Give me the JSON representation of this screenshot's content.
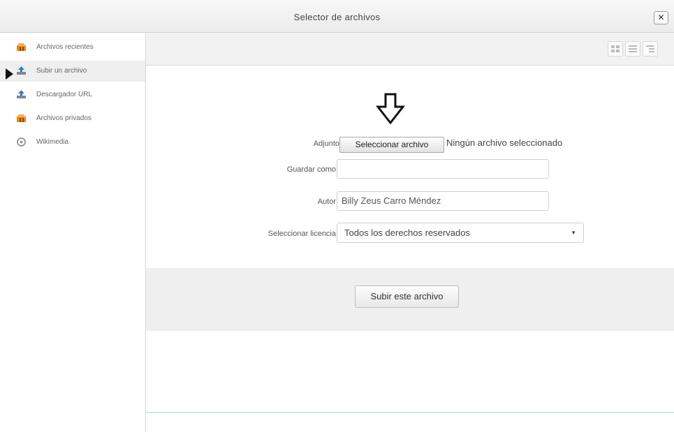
{
  "window": {
    "title": "Selector de archivos",
    "close_glyph": "✕"
  },
  "sidebar": {
    "items": [
      {
        "label": "Archivos recientes",
        "icon": "recent-files-icon"
      },
      {
        "label": "Subir un archivo",
        "icon": "upload-icon"
      },
      {
        "label": "Descargador URL",
        "icon": "url-downloader-icon"
      },
      {
        "label": "Archivos privados",
        "icon": "private-files-icon"
      },
      {
        "label": "Wikimedia",
        "icon": "wikimedia-icon"
      }
    ],
    "active_index": 1
  },
  "toolbar": {
    "views": [
      "icon-view-icon",
      "list-view-icon",
      "tree-view-icon"
    ]
  },
  "form": {
    "attachment_label": "Adjunto",
    "choose_file_button": "Seleccionar archivo",
    "no_file_text": "Ningún archivo seleccionado",
    "save_as_label": "Guardar como",
    "save_as_value": "",
    "author_label": "Autor",
    "author_value": "Billy Zeus  Carro Méndez",
    "license_label": "Seleccionar licencia",
    "license_value": "Todos los derechos reservados",
    "submit_button": "Subir este archivo"
  },
  "colors": {
    "accent_orange": "#e8891a",
    "upload_blue": "#3a7ab8",
    "band_gray": "#efefef"
  }
}
